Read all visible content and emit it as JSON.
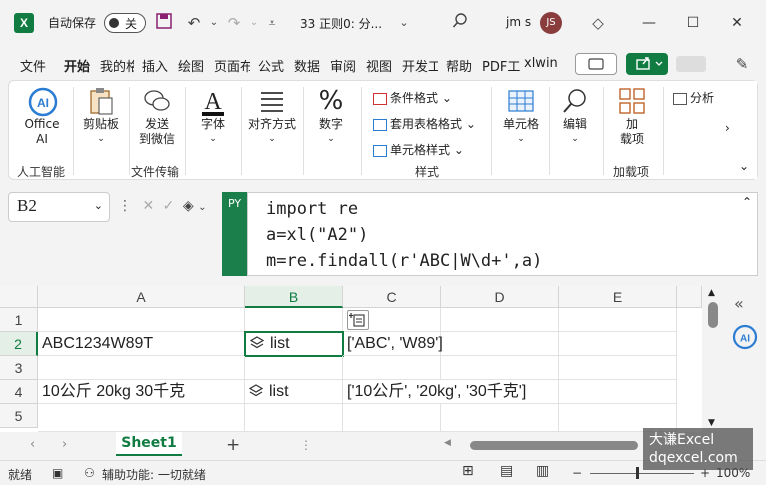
{
  "titlebar": {
    "autosave_label": "自动保存",
    "autosave_state": "关",
    "doc_title": "33 正则0: 分...",
    "user_name": "jm s",
    "avatar_initials": "JS"
  },
  "tabs": [
    "文件",
    "开始",
    "我的格",
    "插入",
    "绘图",
    "页面布",
    "公式",
    "数据",
    "审阅",
    "视图",
    "开发工",
    "帮助",
    "PDF工",
    "xlwin"
  ],
  "ribbon": {
    "office_ai": "Office\nAI",
    "clipboard": "剪贴板",
    "send_wechat": "发送\n到微信",
    "font": "字体",
    "alignment": "对齐方式",
    "number": "数字",
    "conditional_format": "条件格式",
    "table_format": "套用表格格式",
    "cell_style": "单元格样式",
    "cells": "单元格",
    "editing": "编辑",
    "addins": "加\n载项",
    "analyze": "分析",
    "group_ai": "人工智能",
    "group_transfer": "文件传输",
    "group_style": "样式",
    "group_addins": "加载项"
  },
  "namebox": "B2",
  "formula_badge": "PY",
  "formula_lines": [
    "import re",
    "a=xl(\"A2\")",
    "m=re.findall(r'ABC|W\\d+',a)"
  ],
  "grid": {
    "columns": [
      "A",
      "B",
      "C",
      "D",
      "E"
    ],
    "rows": [
      "1",
      "2",
      "3",
      "4",
      "5"
    ],
    "a2": "ABC1234W89T",
    "b2": "list",
    "c2": "['ABC', 'W89']",
    "a4": "10公斤 20kg 30千克",
    "b4": "list",
    "c4": "['10公斤', '20kg', '30千克']"
  },
  "sheet_tab": "Sheet1",
  "status": {
    "ready": "就绪",
    "accessibility": "辅助功能: 一切就绪",
    "zoom": "100%"
  },
  "watermark": {
    "line1": "大谦Excel",
    "line2": "dqexcel.com"
  },
  "colors": {
    "accent": "#107c41",
    "avatar": "#8a3d3d"
  }
}
